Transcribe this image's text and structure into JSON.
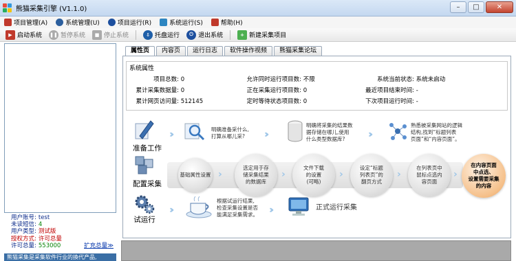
{
  "window": {
    "title": "熊猫采集引擎  (V1.1.0)",
    "minimize": "–",
    "maximize": "□",
    "close": "✕"
  },
  "menu": [
    {
      "label": "项目管理(A)",
      "color": "#c0392b"
    },
    {
      "label": "系统管理(U)",
      "color": "#2c5f9e"
    },
    {
      "label": "项目运行(R)",
      "color": "#1d4f9e"
    },
    {
      "label": "系统运行(S)",
      "color": "#2e86c1"
    },
    {
      "label": "帮助(H)",
      "color": "#c0392b"
    }
  ],
  "toolbar": {
    "start": "启动系统",
    "pause": "暂停系统",
    "stop": "停止系统",
    "tray": "托盘运行",
    "exit": "退出系统",
    "new_project": "新建采集项目"
  },
  "userinfo": {
    "account_label": "用户账号:",
    "account_value": "test",
    "unread_label": "未读短信:",
    "unread_value": "4",
    "type_label": "用户类型:",
    "type_value": "测试版",
    "auth_label": "授权方式:",
    "auth_value": "许可总量",
    "license_label": "许可总量:",
    "license_value": "553000",
    "expand_link": "扩充总量",
    "banner": "熊猫采集是采集软件行业的換代产品,"
  },
  "tabs": [
    "属性页",
    "内容页",
    "运行日志",
    "软件操作视频",
    "熊猫采集论坛"
  ],
  "attributes": {
    "title": "系统属性",
    "rows": [
      {
        "label": "项目总数:",
        "value": "0"
      },
      {
        "label": "允许同时运行项目数:",
        "value": "不限"
      },
      {
        "label": "系统当前状态:",
        "value": "系统未启动"
      },
      {
        "label": "累计采集数据量:",
        "value": "0"
      },
      {
        "label": "正在采集运行项目数:",
        "value": "0"
      },
      {
        "label": "最近项目结束时间:",
        "value": "-"
      },
      {
        "label": "累计网页访问量:",
        "value": "512145"
      },
      {
        "label": "定时等待状态项目数:",
        "value": "0"
      },
      {
        "label": "下次项目运行时间:",
        "value": "-"
      }
    ]
  },
  "flow": {
    "prepare": {
      "title": "准备工作",
      "step1": "明确准备采什么,\n打算从哪儿采?",
      "step2": "明确将采集的结果数\n据存储在哪儿,使用\n什么类型数据库?",
      "step3": "熟悉被采集网站的逻辑\n结构,找到“标题列表\n页面”和“内容页面”。"
    },
    "config": {
      "title": "配置采集",
      "orbs": [
        "基础属性设置",
        "选定用于存\n储采集结果\n的数据库",
        "文件下载\n的设置\n(可略)",
        "设定“标题\n列表页”的\n翻页方式",
        "在列表页中\n鼠标点选内\n容页面",
        "在内容页面\n中点选、\n设置需要采集\n的内容"
      ]
    },
    "run": {
      "title": "试运行",
      "step1": "根据试运行结果,\n检查采集设置是否\n能满足采集需求。",
      "step2": "正式运行采集"
    }
  }
}
